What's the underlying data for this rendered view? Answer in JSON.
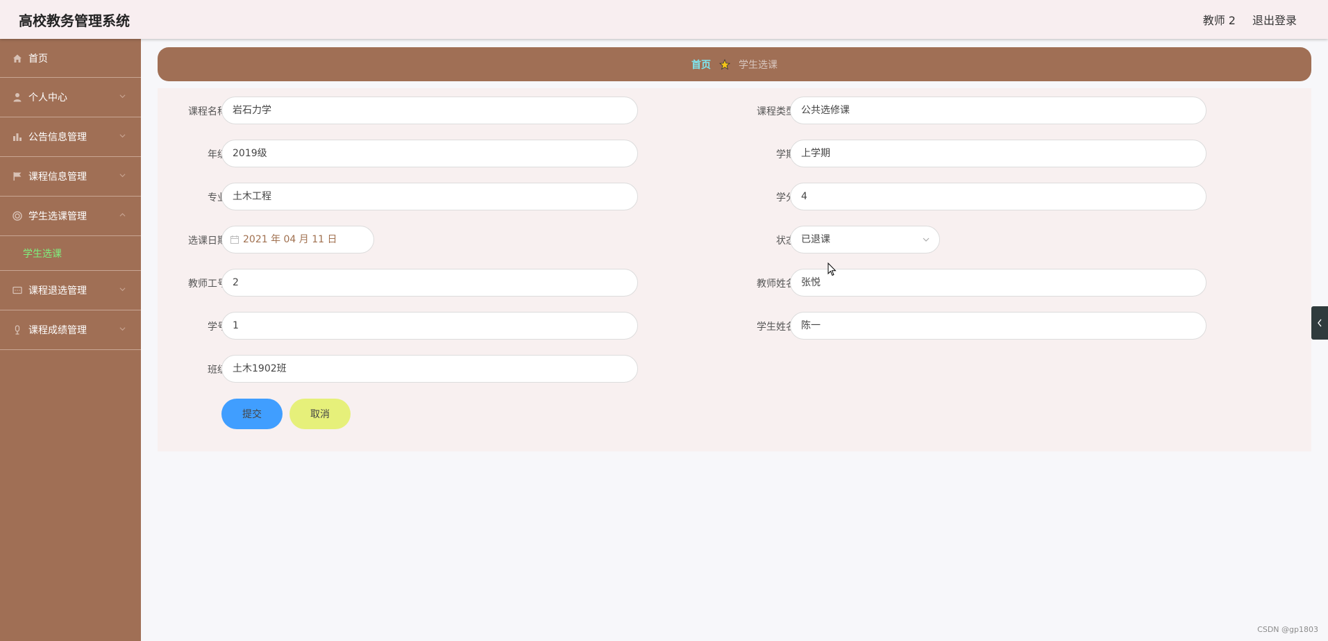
{
  "header": {
    "title": "高校教务管理系统",
    "user": "教师 2",
    "logout": "退出登录"
  },
  "sidebar": {
    "items": [
      {
        "label": "首页",
        "icon": "home-icon"
      },
      {
        "label": "个人中心",
        "icon": "user-icon"
      },
      {
        "label": "公告信息管理",
        "icon": "bar-chart-icon"
      },
      {
        "label": "课程信息管理",
        "icon": "flag-icon"
      },
      {
        "label": "学生选课管理",
        "icon": "target-icon"
      },
      {
        "label": "课程退选管理",
        "icon": "message-icon"
      },
      {
        "label": "课程成绩管理",
        "icon": "microphone-icon"
      }
    ],
    "active_sub": "学生选课"
  },
  "breadcrumb": {
    "home": "首页",
    "current": "学生选课"
  },
  "form": {
    "course_name_label": "课程名称",
    "course_name": "岩石力学",
    "course_type_label": "课程类型",
    "course_type": "公共选修课",
    "grade_label": "年级",
    "grade": "2019级",
    "semester_label": "学期",
    "semester": "上学期",
    "major_label": "专业",
    "major": "土木工程",
    "credit_label": "学分",
    "credit": "4",
    "date_label": "选课日期",
    "date": "2021 年 04 月 11 日",
    "status_label": "状态",
    "status": "已退课",
    "teacher_id_label": "教师工号",
    "teacher_id": "2",
    "teacher_name_label": "教师姓名",
    "teacher_name": "张悦",
    "student_id_label": "学号",
    "student_id": "1",
    "student_name_label": "学生姓名",
    "student_name": "陈一",
    "class_label": "班级",
    "class": "土木1902班",
    "submit": "提交",
    "cancel": "取消"
  },
  "watermark": "CSDN @gp1803",
  "colors": {
    "sidebar": "#a06f55",
    "active_sub": "#7ef07e",
    "breadcrumb_home": "#7ee6f0",
    "submit": "#409eff",
    "cancel": "#e6f07a"
  }
}
